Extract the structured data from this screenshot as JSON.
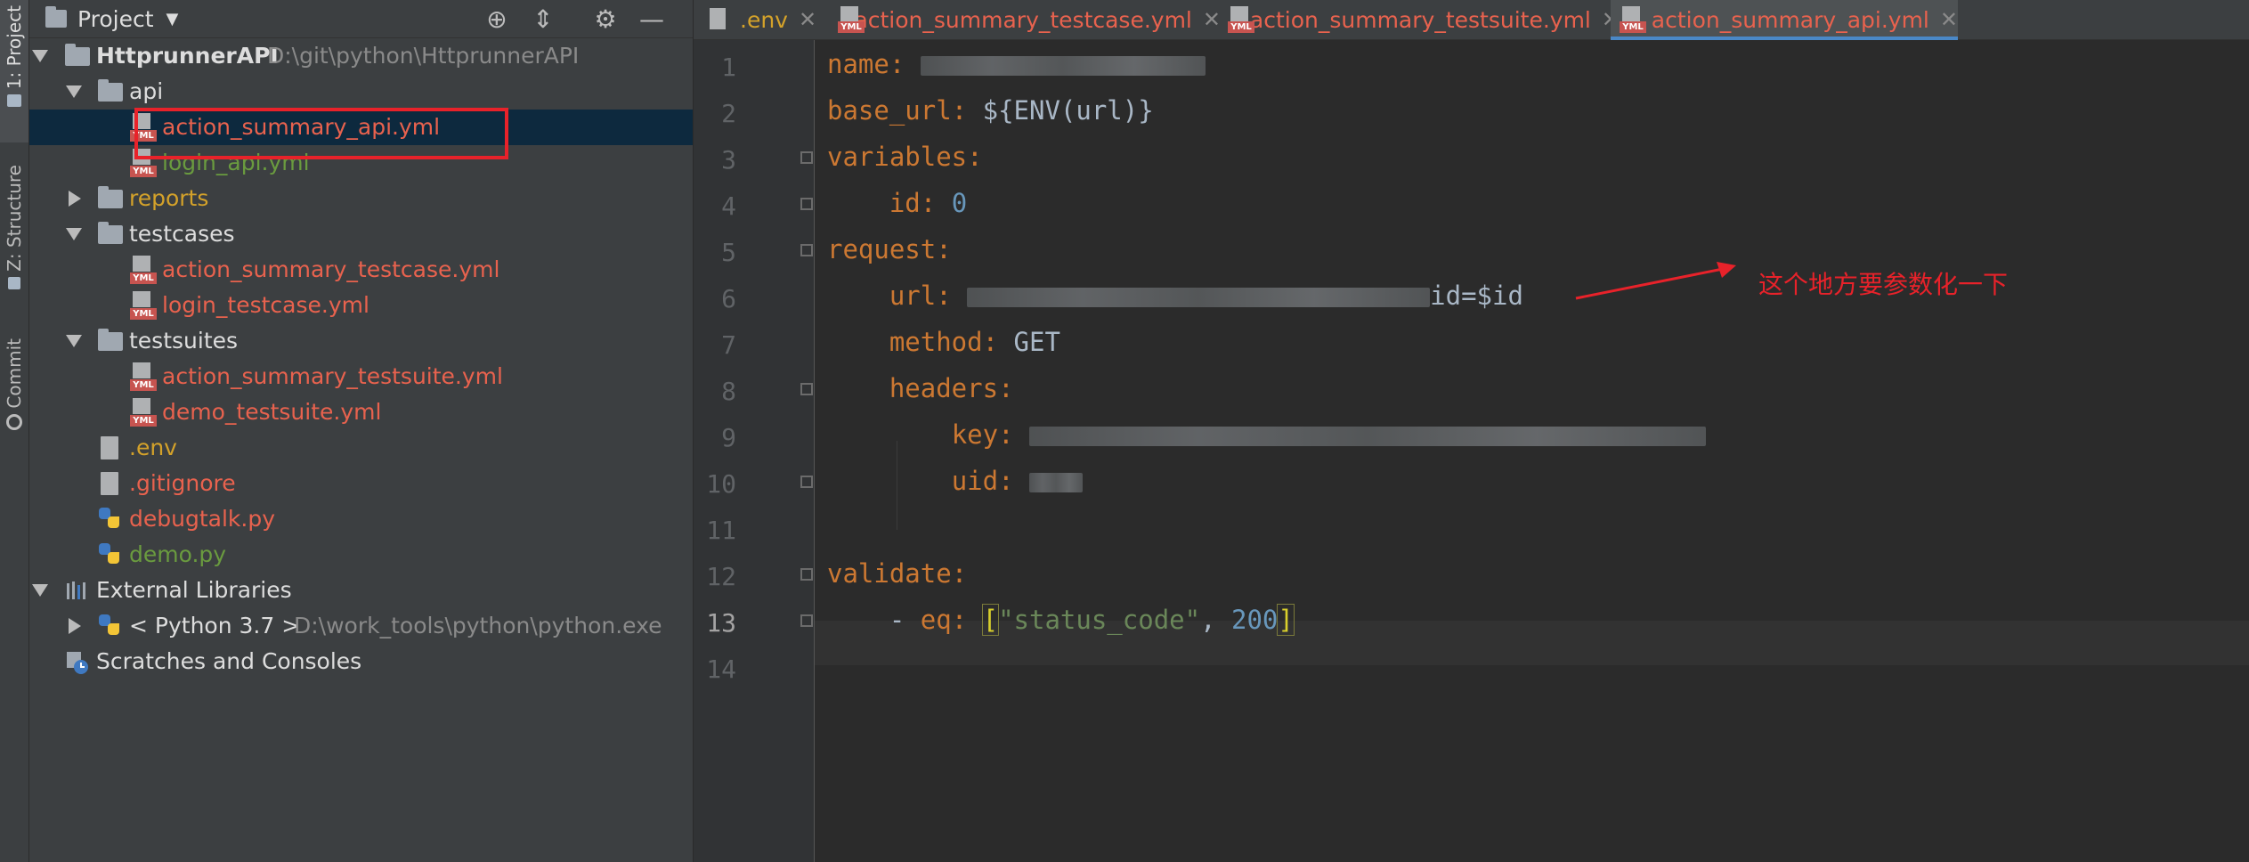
{
  "sidebar_strip": {
    "project_tab": "1: Project",
    "structure_tab": "Z: Structure",
    "commit_tab": "Commit"
  },
  "project_panel": {
    "title": "Project",
    "tree": {
      "root_name": "HttprunnerAPI",
      "root_path": "D:\\git\\python\\HttprunnerAPI",
      "api_folder": "api",
      "api_file_1": "action_summary_api.yml",
      "api_file_2": "login_api.yml",
      "reports_folder": "reports",
      "testcases_folder": "testcases",
      "testcase_file_1": "action_summary_testcase.yml",
      "testcase_file_2": "login_testcase.yml",
      "testsuites_folder": "testsuites",
      "testsuite_file_1": "action_summary_testsuite.yml",
      "testsuite_file_2": "demo_testsuite.yml",
      "env_file": ".env",
      "gitignore_file": ".gitignore",
      "debugtalk_file": "debugtalk.py",
      "demo_file": "demo.py",
      "external_libraries": "External Libraries",
      "python_sdk": "< Python 3.7 >",
      "python_path": "D:\\work_tools\\python\\python.exe",
      "scratches": "Scratches and Consoles"
    }
  },
  "editor_tabs": [
    {
      "label": ".env"
    },
    {
      "label": "action_summary_testcase.yml"
    },
    {
      "label": "action_summary_testsuite.yml"
    },
    {
      "label": "action_summary_api.yml"
    }
  ],
  "editor": {
    "line_numbers": [
      "1",
      "2",
      "3",
      "4",
      "5",
      "6",
      "7",
      "8",
      "9",
      "10",
      "11",
      "12",
      "13",
      "14"
    ],
    "current_line": 13,
    "code": {
      "l1_key": "name",
      "l2_key": "base_url",
      "l2_val": "${ENV(url)}",
      "l3_key": "variables",
      "l4_key": "id",
      "l4_val": "0",
      "l5_key": "request",
      "l6_key": "url",
      "l6_val_tail": "id=$id",
      "l7_key": "method",
      "l7_val": "GET",
      "l8_key": "headers",
      "l9_key": "key",
      "l10_key": "uid",
      "l12_key": "validate",
      "l13_dash": "- ",
      "l13_key": "eq",
      "l13_str": "\"status_code\"",
      "l13_num": "200"
    }
  },
  "annotation": {
    "text": "这个地方要参数化一下",
    "color": "#e8222a"
  },
  "colors": {
    "keyword": "#cc7832",
    "string": "#6a8759",
    "number": "#6897bb",
    "vcs_modified_red": "#e8624e",
    "vcs_added_green": "#6a9b3f",
    "selection": "#0d293e",
    "highlight_box": "#e8222a"
  }
}
